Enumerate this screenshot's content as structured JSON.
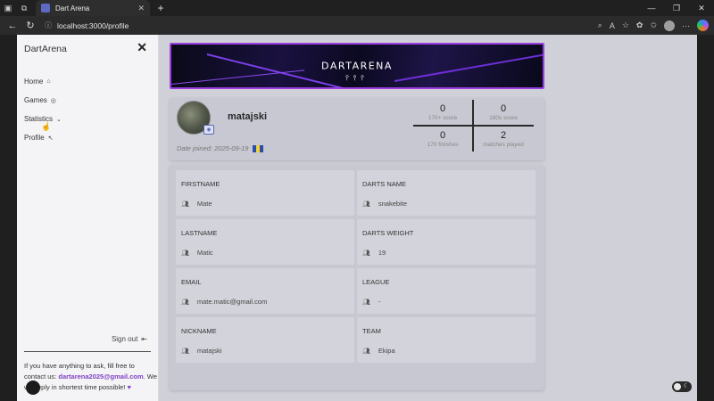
{
  "browser": {
    "tab_title": "Dart Arena",
    "url": "localhost:3000/profile"
  },
  "sidebar": {
    "brand": "DartArena",
    "items": [
      {
        "label": "Home",
        "icon": "home-icon"
      },
      {
        "label": "Games",
        "icon": "dart-icon"
      },
      {
        "label": "Statistics",
        "icon": "chevron-double-down-icon"
      },
      {
        "label": "Profile",
        "icon": "arrow-icon"
      }
    ],
    "signout": "Sign out",
    "help_prefix": "If you have anything to ask, fill free to contact us: ",
    "help_email": "dartarena2025@gmail.com",
    "help_suffix": ". We will reply in shortest time possible!"
  },
  "banner": {
    "logo_text": "DARTARENA"
  },
  "profile": {
    "username": "matajski",
    "date_joined": "Date joined: 2025-09-19",
    "stats": [
      {
        "value": "0",
        "label": "170+ score"
      },
      {
        "value": "0",
        "label": "180s score"
      },
      {
        "value": "0",
        "label": "170 finishes"
      },
      {
        "value": "2",
        "label": "matches played"
      }
    ]
  },
  "fields": {
    "firstname": {
      "label": "FIRSTNAME",
      "value": "Mate"
    },
    "darts_name": {
      "label": "DARTS NAME",
      "value": "snakebite"
    },
    "lastname": {
      "label": "LASTNAME",
      "value": "Matic"
    },
    "darts_weight": {
      "label": "DARTS WEIGHT",
      "value": "19"
    },
    "email": {
      "label": "EMAIL",
      "value": "mate.matic@gmail.com"
    },
    "league": {
      "label": "LEAGUE",
      "value": "-"
    },
    "nickname": {
      "label": "NICKNAME",
      "value": "matajski"
    },
    "team": {
      "label": "TEAM",
      "value": "Ekipa"
    }
  },
  "colors": {
    "accent": "#9b3fe0",
    "email_link": "#7e3fc4"
  }
}
